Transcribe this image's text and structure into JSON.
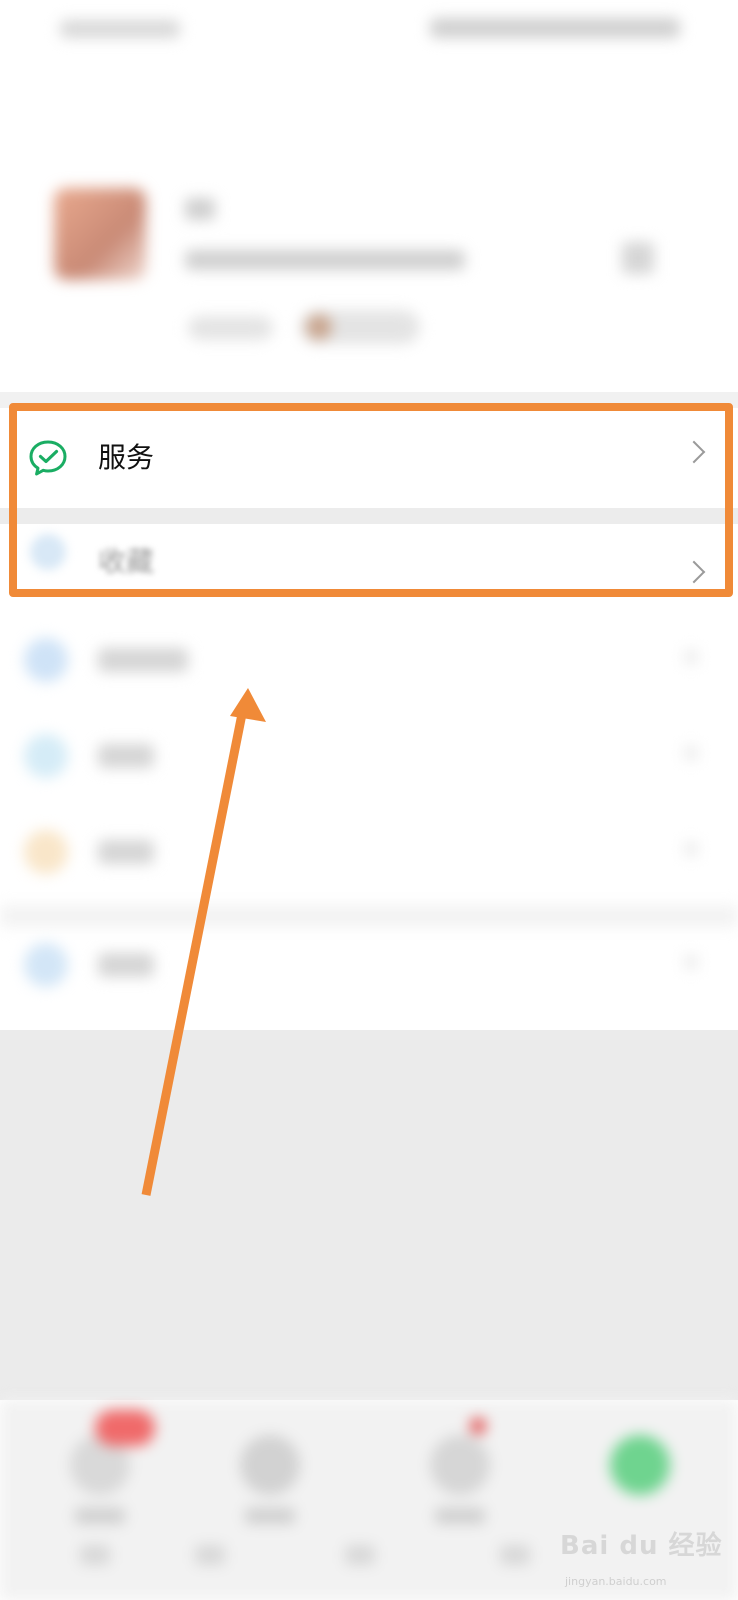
{
  "services_row": {
    "label": "服务",
    "icon": "wechat-pay-icon",
    "icon_color": "#1aad63"
  },
  "favorites_row": {
    "label": "收藏",
    "icon": "favorites-icon"
  },
  "blurred_list": [
    {
      "icon": "moments-icon",
      "icon_color": "#cfe3f7"
    },
    {
      "icon": "card-icon",
      "icon_color": "#d5ecf7"
    },
    {
      "icon": "emoji-icon",
      "icon_color": "#f9e6c9"
    },
    {
      "icon": "settings-icon",
      "icon_color": "#d3e6f7"
    }
  ],
  "tabbar": {
    "tabs": [
      {
        "icon": "chats-icon"
      },
      {
        "icon": "contacts-icon"
      },
      {
        "icon": "discover-icon"
      },
      {
        "icon": "me-icon",
        "active_color": "#6fd48f"
      }
    ]
  },
  "annotation": {
    "highlight_color": "#f08a38"
  },
  "watermark": {
    "text": "Bai du 经验",
    "sub": "jingyan.baidu.com"
  }
}
